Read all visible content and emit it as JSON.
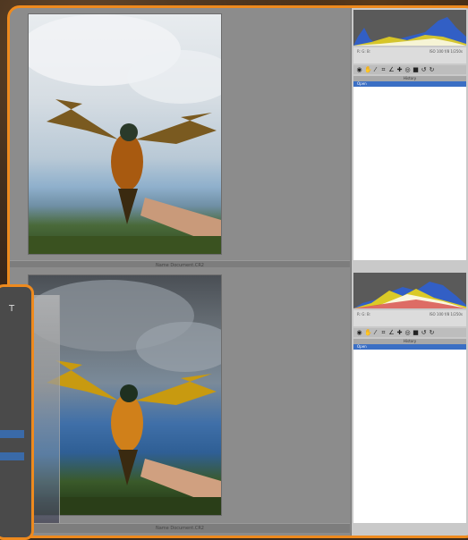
{
  "top_view": {
    "status_text": "Name Document.CR2",
    "info": {
      "line1_left": "R:\nG:\nB:",
      "line1_right": "ISO 100  f/8  1/250s",
      "line2_right": "24mm"
    },
    "panel_header": "History",
    "history_item": "Open"
  },
  "bottom_view": {
    "status_text": "Name Document.CR2",
    "info": {
      "line1_left": "R:\nG:\nB:",
      "line1_right": "ISO 100  f/8  1/250s",
      "line2_right": "24mm"
    },
    "panel_header": "History",
    "history_item": "Open"
  },
  "toolbar_icons": [
    "zoom-icon",
    "hand-icon",
    "eyedropper-icon",
    "crop-icon",
    "straighten-icon",
    "retouch-icon",
    "redeye-icon",
    "brush-icon",
    "rotate-left-icon",
    "rotate-right-icon"
  ],
  "overlay": {
    "tool_icon": "T",
    "items": [
      "",
      "",
      "",
      "",
      ""
    ]
  },
  "colors": {
    "frame": "#ee8a1e",
    "selection": "#3b6fc4"
  }
}
